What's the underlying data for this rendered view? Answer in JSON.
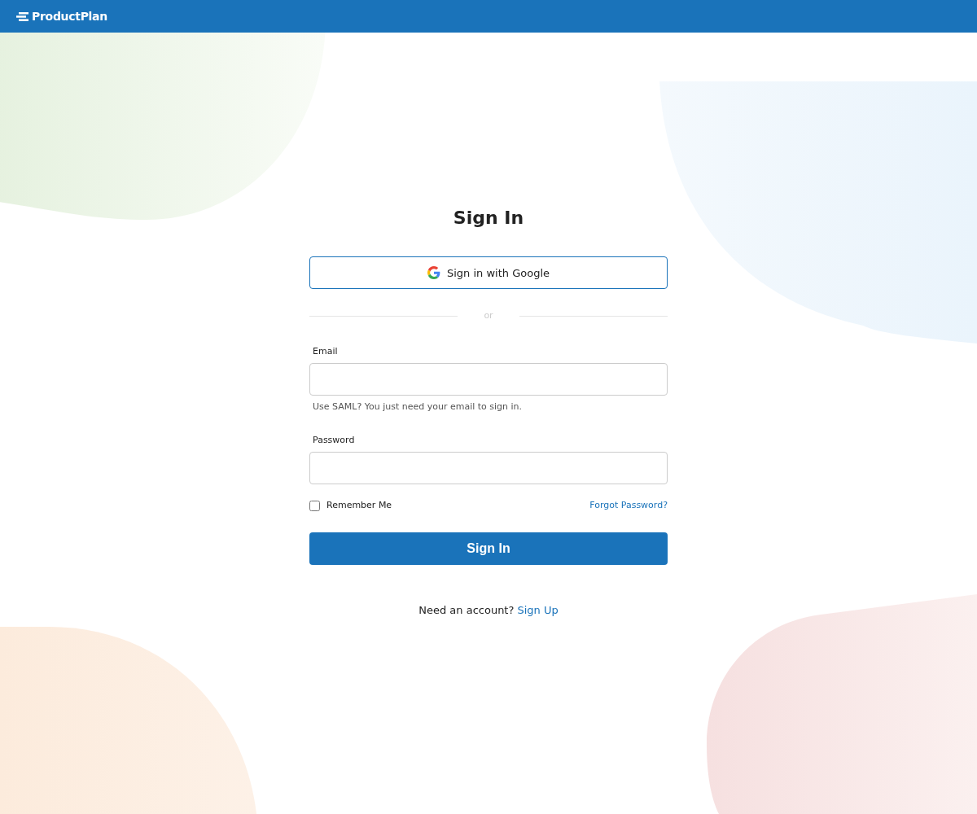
{
  "header": {
    "logo": "ProductPlan"
  },
  "title": "Sign In",
  "google_button": "Sign in with Google",
  "divider": "or",
  "fields": [
    {
      "label": "Email",
      "hint": "Use SAML? You just need your email to sign in."
    },
    {
      "label": "Password"
    }
  ],
  "remember_me": {
    "label": "Remember Me",
    "checked": false
  },
  "forgot_link": "Forgot Password?",
  "submit_button": "Sign In",
  "signup": {
    "text": "Need an account?",
    "link": "Sign Up"
  }
}
